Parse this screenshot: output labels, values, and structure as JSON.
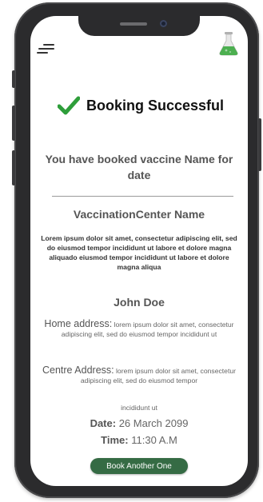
{
  "header": {
    "menu_icon": "hamburger-menu-icon",
    "app_icon": "flask-icon",
    "app_icon_color": "#4caf50"
  },
  "confirmation": {
    "icon": "check-icon",
    "icon_color": "#2e9e3a",
    "title": "Booking Successful",
    "message": "You have booked vaccine Name for date"
  },
  "center": {
    "name": "VaccinationCenter Name",
    "description": "Lorem ipsum dolor sit amet, consectetur adipiscing elit, sed do eiusmod tempor incididunt ut labore et dolore magna aliquado eiusmod tempor incididunt ut labore et dolore magna aliqua"
  },
  "patient": {
    "name": "John Doe",
    "home_label": "Home address:",
    "home_value": "lorem ipsum dolor sit amet, consectetur adipiscing elit, sed do eiusmod tempor incididunt ut",
    "centre_label": "Centre Address:",
    "centre_value": "lorem ipsum dolor sit amet, consectetur adipiscing elit, sed do eiusmod tempor",
    "centre_value_tail": "incididunt ut"
  },
  "appointment": {
    "date_label": "Date:",
    "date_value": "26 March 2099",
    "time_label": "Time:",
    "time_value": "11:30 A.M"
  },
  "actions": {
    "book_another_label": "Book Another One",
    "button_color": "#356b44"
  }
}
